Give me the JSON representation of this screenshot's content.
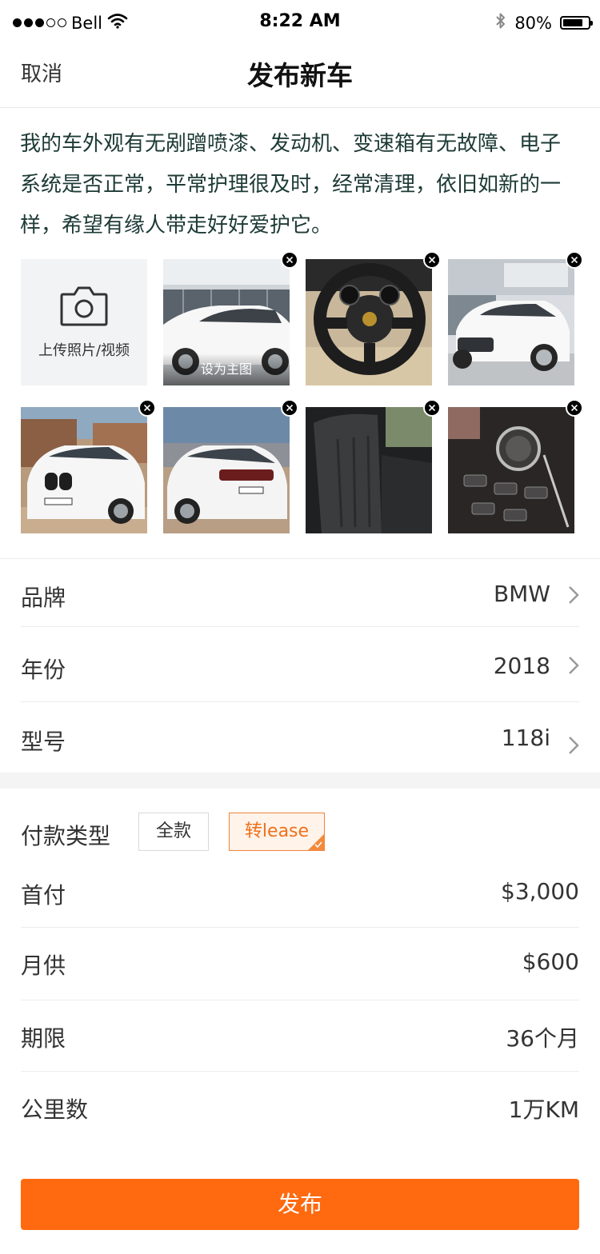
{
  "status_bar": {
    "carrier": "Bell",
    "time": "8:22 AM",
    "battery_percent": "80%",
    "battery_level": 0.8,
    "signal_bars_filled": 3,
    "signal_bars_total": 5
  },
  "nav": {
    "cancel_label": "取消",
    "title": "发布新车"
  },
  "description": "我的车外观有无剐蹭喷漆、发动机、变速箱有无故障、电子系统是否正常，平常护理很及时，经常清理，依旧如新的一样，希望有缘人带走好好爱护它。",
  "photos": {
    "upload_label": "上传照片/视频",
    "set_cover_label": "设为主图",
    "items": [
      {
        "name": "white-porsche-macan-side"
      },
      {
        "name": "porsche-steering-wheel-interior"
      },
      {
        "name": "white-porsche-macan-front"
      },
      {
        "name": "white-bmw-x5-front"
      },
      {
        "name": "white-bmw-x5-rear"
      },
      {
        "name": "black-leather-seat"
      },
      {
        "name": "bmw-center-console"
      }
    ]
  },
  "car_info": {
    "brand_label": "品牌",
    "brand_value": "BMW",
    "year_label": "年份",
    "year_value": "2018",
    "model_label": "型号",
    "model_value": "118i"
  },
  "payment": {
    "type_label": "付款类型",
    "options": [
      "全款",
      "转lease"
    ],
    "selected": "转lease",
    "down_payment_label": "首付",
    "down_payment_value": "$3,000",
    "monthly_label": "月供",
    "monthly_value": "$600",
    "term_label": "期限",
    "term_value": "36个月",
    "mileage_label": "公里数",
    "mileage_value": "1万KM"
  },
  "publish_label": "发布",
  "colors": {
    "accent": "#ff6a10",
    "selected_option_text": "#f0701a",
    "selected_option_bg": "#fff3ea",
    "description_text": "#1d3a35"
  }
}
